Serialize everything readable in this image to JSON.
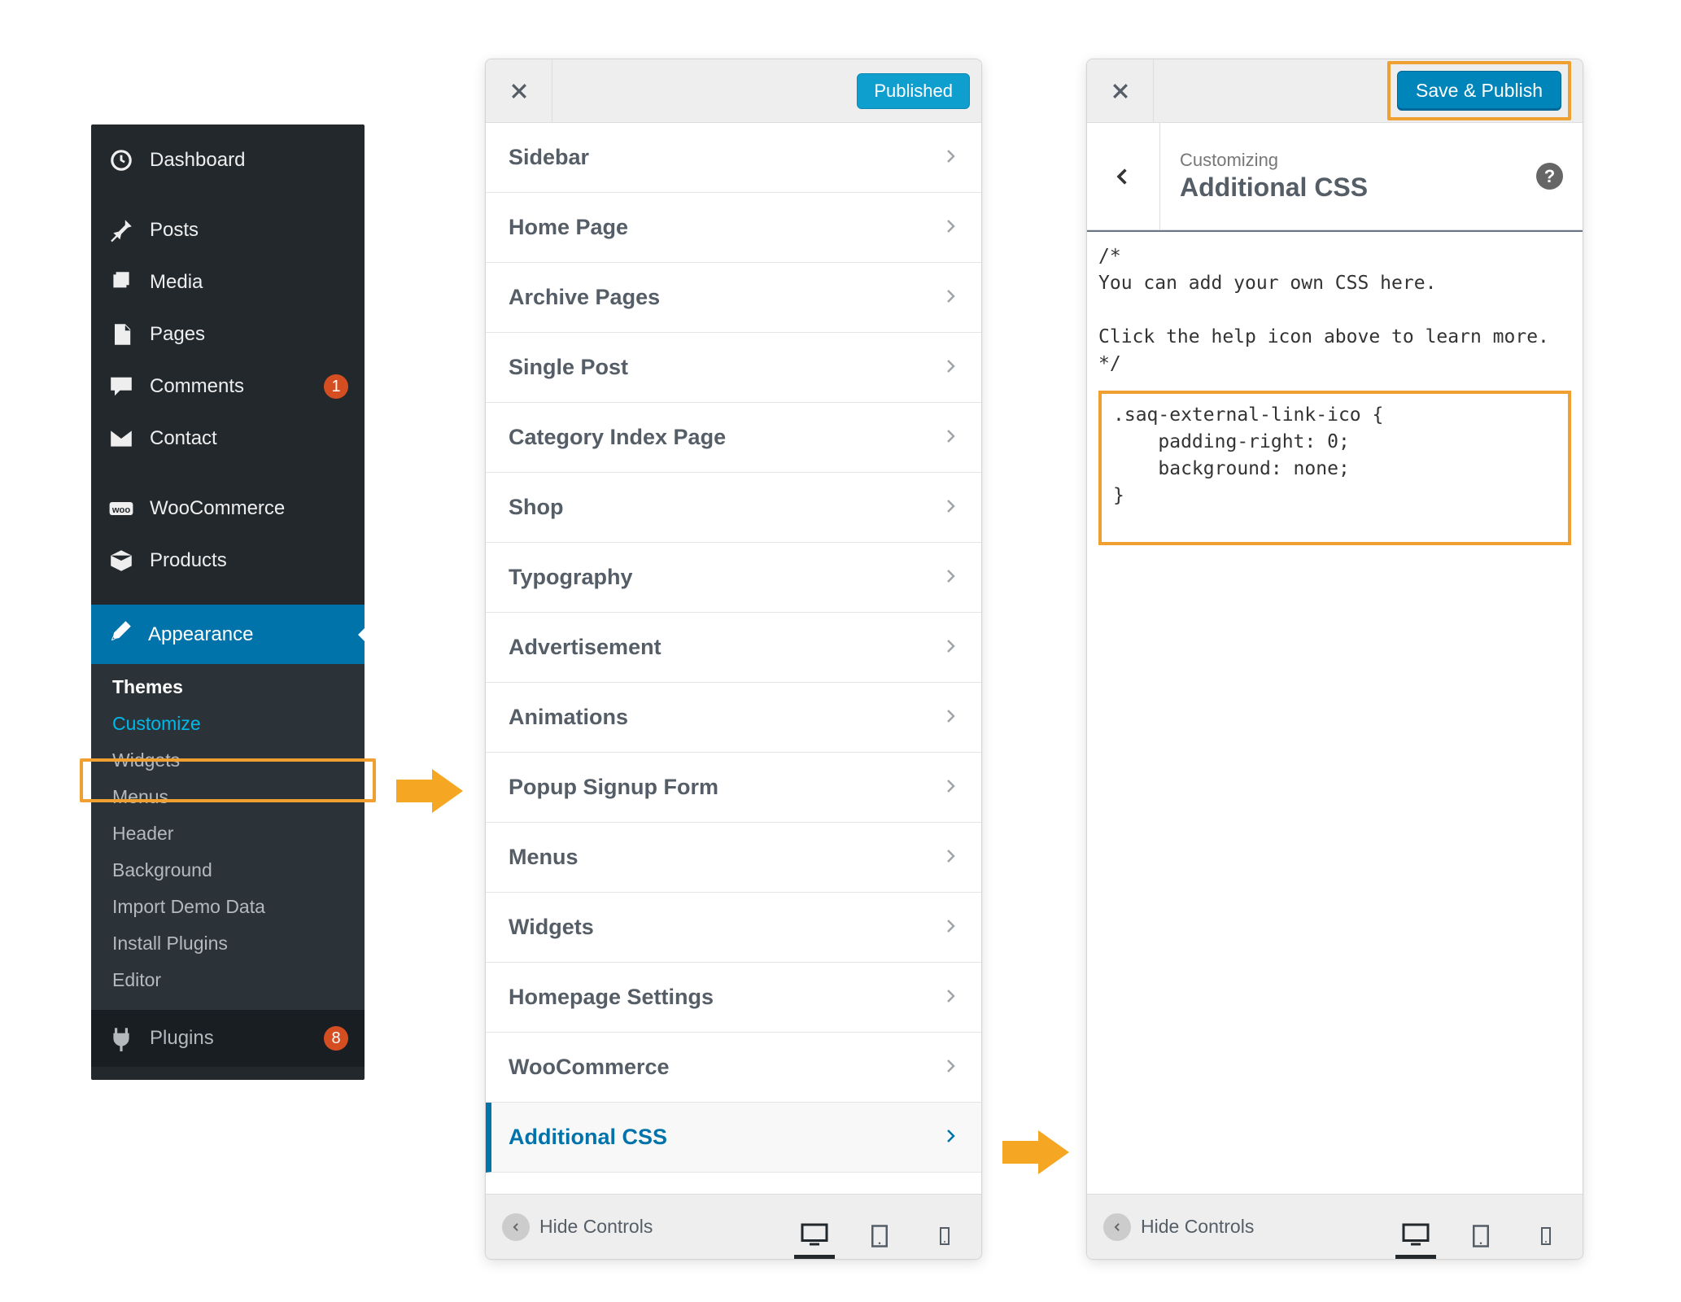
{
  "wp_sidebar": {
    "items": [
      {
        "icon": "dashboard",
        "label": "Dashboard"
      },
      {
        "icon": "pin",
        "label": "Posts"
      },
      {
        "icon": "media",
        "label": "Media"
      },
      {
        "icon": "pages",
        "label": "Pages"
      },
      {
        "icon": "comments",
        "label": "Comments",
        "badge": "1"
      },
      {
        "icon": "envelope",
        "label": "Contact"
      },
      {
        "icon": "woo",
        "label": "WooCommerce"
      },
      {
        "icon": "box",
        "label": "Products"
      }
    ],
    "appearance_label": "Appearance",
    "submenu": [
      {
        "label": "Themes",
        "state": "current"
      },
      {
        "label": "Customize",
        "state": "active"
      },
      {
        "label": "Widgets",
        "state": ""
      },
      {
        "label": "Menus",
        "state": ""
      },
      {
        "label": "Header",
        "state": ""
      },
      {
        "label": "Background",
        "state": ""
      },
      {
        "label": "Import Demo Data",
        "state": ""
      },
      {
        "label": "Install Plugins",
        "state": ""
      },
      {
        "label": "Editor",
        "state": ""
      }
    ],
    "plugins_label": "Plugins",
    "plugins_badge": "8"
  },
  "panelA": {
    "published_label": "Published",
    "sections": [
      "Sidebar",
      "Home Page",
      "Archive Pages",
      "Single Post",
      "Category Index Page",
      "Shop",
      "Typography",
      "Advertisement",
      "Animations",
      "Popup Signup Form",
      "Menus",
      "Widgets",
      "Homepage Settings",
      "WooCommerce",
      "Additional CSS"
    ],
    "active_index": 14,
    "footer": {
      "hide": "Hide Controls"
    }
  },
  "panelB": {
    "save_label": "Save & Publish",
    "eyebrow": "Customizing",
    "title": "Additional CSS",
    "help": "?",
    "comment": "/*\nYou can add your own CSS here.\n\nClick the help icon above to learn more.\n*/",
    "css_code": ".saq-external-link-ico {\n    padding-right: 0;\n    background: none;\n}",
    "footer": {
      "hide": "Hide Controls"
    }
  }
}
